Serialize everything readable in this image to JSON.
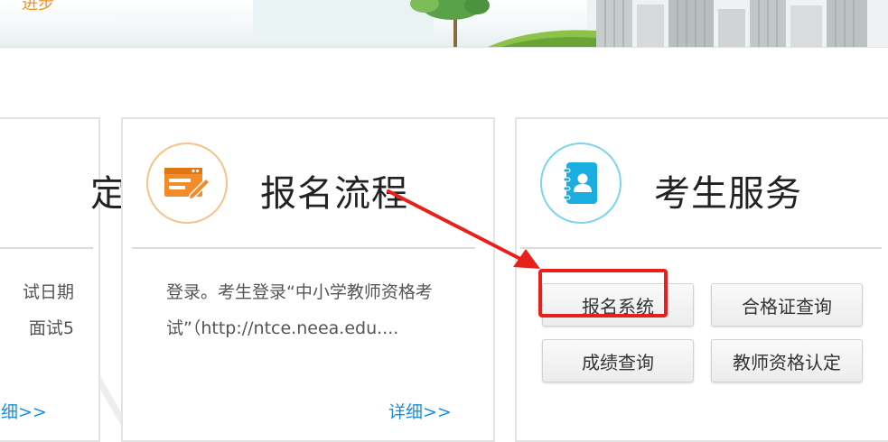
{
  "banner": {
    "text": "进步"
  },
  "cards": {
    "left": {
      "title": "定",
      "lines": [
        "试日期",
        "面试5"
      ],
      "more": "详细>>"
    },
    "middle": {
      "title": "报名流程",
      "desc": "登录。考生登录“中小学教师资格考试”（http://ntce.neea.edu....",
      "more": "详细>>",
      "icon": "form-edit-icon"
    },
    "right": {
      "title": "考生服务",
      "icon": "contact-book-icon",
      "buttons": [
        "报名系统",
        "合格证查询",
        "成绩查询",
        "教师资格认定"
      ]
    }
  },
  "colors": {
    "accent_orange": "#f0921e",
    "accent_blue": "#1aaee0",
    "link_blue": "#1a8fd6",
    "highlight_red": "#e8201c"
  }
}
